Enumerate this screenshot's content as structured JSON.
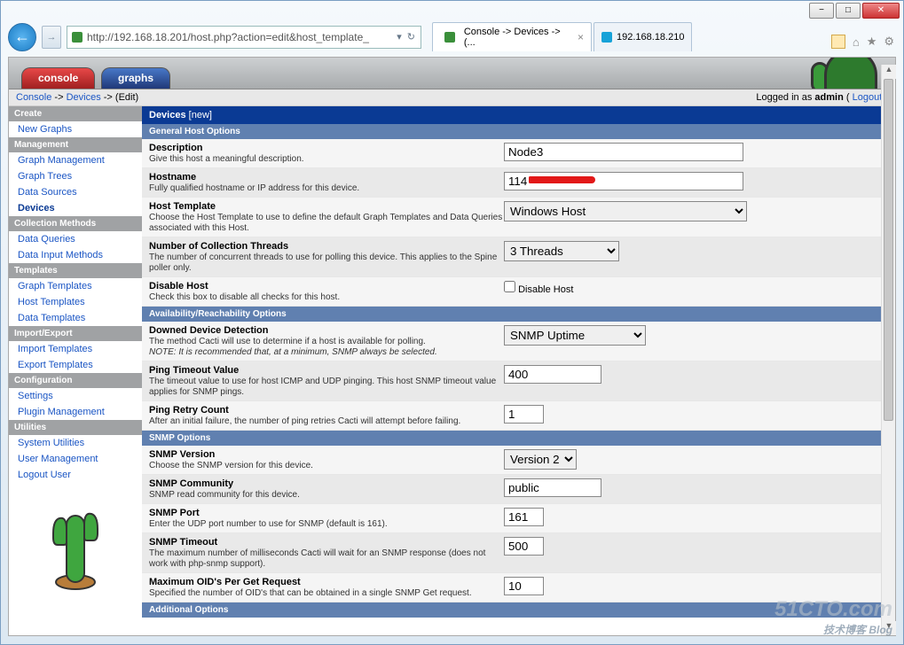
{
  "window": {
    "minimize": "−",
    "maximize": "□",
    "close": "✕"
  },
  "addressbar": {
    "url": "http://192.168.18.201/host.php?action=edit&host_template_",
    "dropdown": "▾",
    "search": "🔍",
    "refresh": "↻"
  },
  "browserTabs": {
    "tab1": "Console -> Devices -> (...",
    "tab2": "192.168.18.210"
  },
  "topTabs": {
    "console": "console",
    "graphs": "graphs"
  },
  "breadcrumb": {
    "console": "Console",
    "sep1": " -> ",
    "devices": "Devices",
    "sep2": " -> (Edit)",
    "logged": "Logged in as ",
    "user": "admin",
    "logoutL": " (",
    "logout": "Logout",
    "logoutR": ")"
  },
  "sidebar": {
    "create": "Create",
    "newGraphs": "New Graphs",
    "management": "Management",
    "graphMgmt": "Graph Management",
    "graphTrees": "Graph Trees",
    "dataSources": "Data Sources",
    "devices": "Devices",
    "collMethods": "Collection Methods",
    "dataQueries": "Data Queries",
    "dataInput": "Data Input Methods",
    "templates": "Templates",
    "graphTpl": "Graph Templates",
    "hostTpl": "Host Templates",
    "dataTpl": "Data Templates",
    "impExp": "Import/Export",
    "impTpl": "Import Templates",
    "expTpl": "Export Templates",
    "config": "Configuration",
    "settings": "Settings",
    "plugin": "Plugin Management",
    "utilities": "Utilities",
    "sysUtil": "System Utilities",
    "userMgmt": "User Management",
    "logoutUser": "Logout User"
  },
  "panel": {
    "title": "Devices ",
    "titleNew": "[new]",
    "secGeneral": "General Host Options",
    "secAvail": "Availability/Reachability Options",
    "secSnmp": "SNMP Options",
    "secAdd": "Additional Options"
  },
  "fields": {
    "description": {
      "label": "Description",
      "hint": "Give this host a meaningful description.",
      "value": "Node3"
    },
    "hostname": {
      "label": "Hostname",
      "hint": "Fully qualified hostname or IP address for this device.",
      "value": "114"
    },
    "hostTemplate": {
      "label": "Host Template",
      "hint": "Choose the Host Template to use to define the default Graph Templates and Data Queries associated with this Host.",
      "value": "Windows Host"
    },
    "threads": {
      "label": "Number of Collection Threads",
      "hint": "The number of concurrent threads to use for polling this device. This applies to the Spine poller only.",
      "value": "3 Threads"
    },
    "disable": {
      "label": "Disable Host",
      "hint": "Check this box to disable all checks for this host.",
      "cblabel": "Disable Host"
    },
    "downed": {
      "label": "Downed Device Detection",
      "hint": "The method Cacti will use to determine if a host is available for polling.",
      "note": "NOTE: It is recommended that, at a minimum, SNMP always be selected.",
      "value": "SNMP Uptime"
    },
    "pingTimeout": {
      "label": "Ping Timeout Value",
      "hint": "The timeout value to use for host ICMP and UDP pinging. This host SNMP timeout value applies for SNMP pings.",
      "value": "400"
    },
    "pingRetry": {
      "label": "Ping Retry Count",
      "hint": "After an initial failure, the number of ping retries Cacti will attempt before failing.",
      "value": "1"
    },
    "snmpVer": {
      "label": "SNMP Version",
      "hint": "Choose the SNMP version for this device.",
      "value": "Version 2"
    },
    "snmpComm": {
      "label": "SNMP Community",
      "hint": "SNMP read community for this device.",
      "value": "public"
    },
    "snmpPort": {
      "label": "SNMP Port",
      "hint": "Enter the UDP port number to use for SNMP (default is 161).",
      "value": "161"
    },
    "snmpTimeout": {
      "label": "SNMP Timeout",
      "hint": "The maximum number of milliseconds Cacti will wait for an SNMP response (does not work with php-snmp support).",
      "value": "500"
    },
    "maxOid": {
      "label": "Maximum OID's Per Get Request",
      "hint": "Specified the number of OID's that can be obtained in a single SNMP Get request.",
      "value": "10"
    }
  },
  "watermark": {
    "main": "51CTO.com",
    "sub": "技术博客  Blog"
  }
}
